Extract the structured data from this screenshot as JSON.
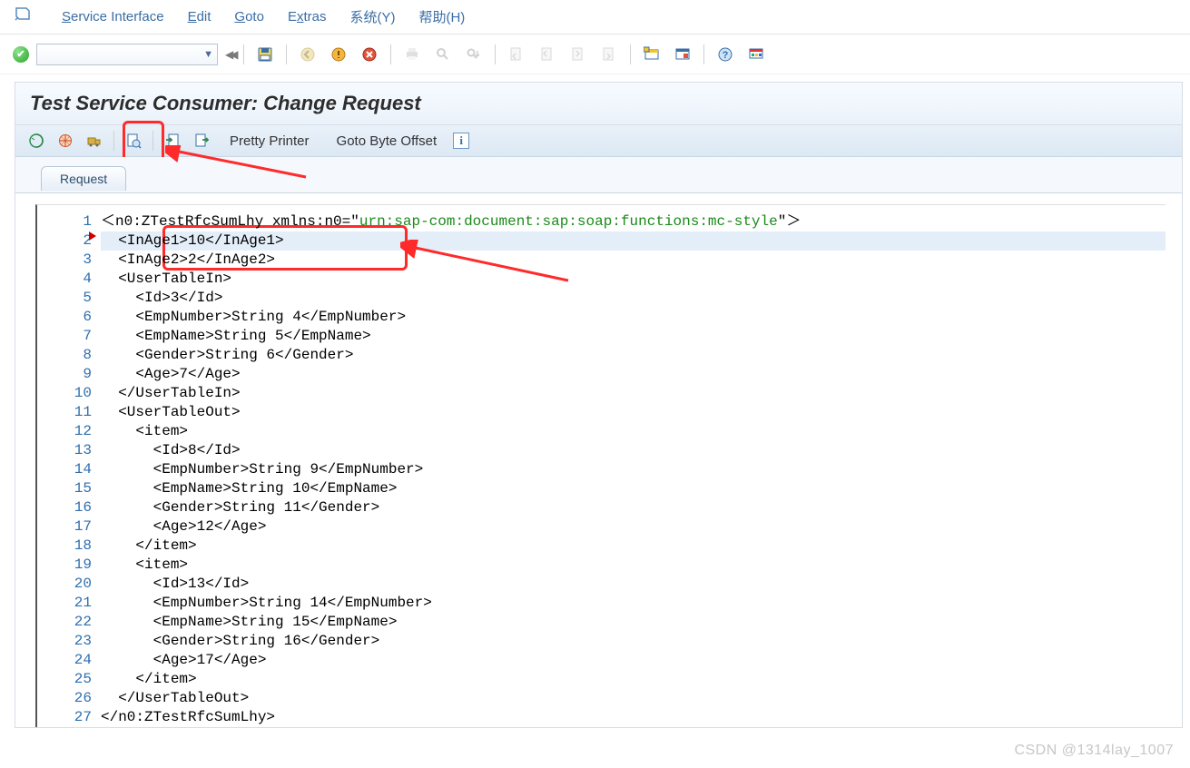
{
  "menus": {
    "service_interface": "Service Interface",
    "edit": "Edit",
    "goto": "Goto",
    "extras": "Extras",
    "system": "系统(Y)",
    "help": "帮助(H)"
  },
  "page_title": "Test Service Consumer: Change Request",
  "sub_toolbar": {
    "pretty_printer": "Pretty Printer",
    "goto_byte_offset": "Goto Byte Offset"
  },
  "tab": {
    "request": "Request"
  },
  "code": {
    "namespace_value": "urn:sap-com:document:sap:soap:functions:mc-style",
    "lines": [
      {
        "n": 1,
        "indent": 0,
        "text_pre": "<n0:ZTestRfcSumLhy xmlns:n0=\"",
        "str": "urn:sap-com:document:sap:soap:functions:mc-style",
        "text_post": "\">"
      },
      {
        "n": 2,
        "indent": 1,
        "text": "<InAge1>10</InAge1>"
      },
      {
        "n": 3,
        "indent": 1,
        "text": "<InAge2>2</InAge2>"
      },
      {
        "n": 4,
        "indent": 1,
        "text": "<UserTableIn>"
      },
      {
        "n": 5,
        "indent": 2,
        "text": "<Id>3</Id>"
      },
      {
        "n": 6,
        "indent": 2,
        "text": "<EmpNumber>String 4</EmpNumber>"
      },
      {
        "n": 7,
        "indent": 2,
        "text": "<EmpName>String 5</EmpName>"
      },
      {
        "n": 8,
        "indent": 2,
        "text": "<Gender>String 6</Gender>"
      },
      {
        "n": 9,
        "indent": 2,
        "text": "<Age>7</Age>"
      },
      {
        "n": 10,
        "indent": 1,
        "text": "</UserTableIn>"
      },
      {
        "n": 11,
        "indent": 1,
        "text": "<UserTableOut>"
      },
      {
        "n": 12,
        "indent": 2,
        "text": "<item>"
      },
      {
        "n": 13,
        "indent": 3,
        "text": "<Id>8</Id>"
      },
      {
        "n": 14,
        "indent": 3,
        "text": "<EmpNumber>String 9</EmpNumber>"
      },
      {
        "n": 15,
        "indent": 3,
        "text": "<EmpName>String 10</EmpName>"
      },
      {
        "n": 16,
        "indent": 3,
        "text": "<Gender>String 11</Gender>"
      },
      {
        "n": 17,
        "indent": 3,
        "text": "<Age>12</Age>"
      },
      {
        "n": 18,
        "indent": 2,
        "text": "</item>"
      },
      {
        "n": 19,
        "indent": 2,
        "text": "<item>"
      },
      {
        "n": 20,
        "indent": 3,
        "text": "<Id>13</Id>"
      },
      {
        "n": 21,
        "indent": 3,
        "text": "<EmpNumber>String 14</EmpNumber>"
      },
      {
        "n": 22,
        "indent": 3,
        "text": "<EmpName>String 15</EmpName>"
      },
      {
        "n": 23,
        "indent": 3,
        "text": "<Gender>String 16</Gender>"
      },
      {
        "n": 24,
        "indent": 3,
        "text": "<Age>17</Age>"
      },
      {
        "n": 25,
        "indent": 2,
        "text": "</item>"
      },
      {
        "n": 26,
        "indent": 1,
        "text": "</UserTableOut>"
      },
      {
        "n": 27,
        "indent": 0,
        "text": "</n0:ZTestRfcSumLhy>"
      }
    ],
    "highlighted_line": 2
  },
  "watermark": "CSDN @1314lay_1007"
}
